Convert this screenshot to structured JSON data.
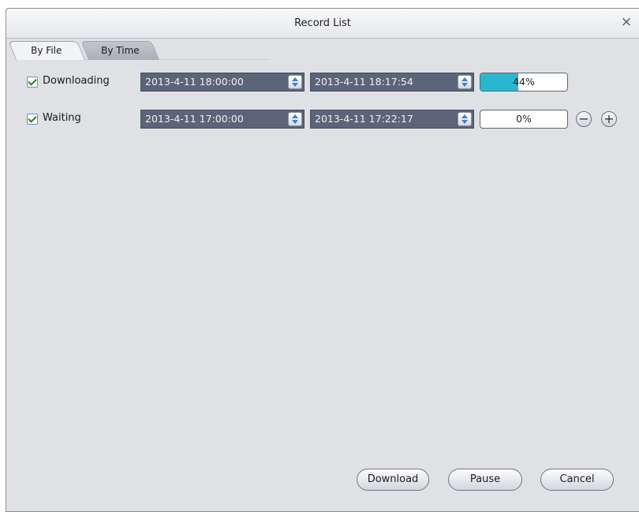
{
  "window": {
    "title": "Record List",
    "close_label": "×"
  },
  "tabs": [
    {
      "label": "By File",
      "active": true
    },
    {
      "label": "By Time",
      "active": false
    }
  ],
  "rows": [
    {
      "checked": true,
      "label": "Downloading",
      "start": "2013-4-11 18:00:00",
      "end": "2013-4-11 18:17:54",
      "progress_text": "44%",
      "progress": 44
    },
    {
      "checked": true,
      "label": "Waiting",
      "start": "2013-4-11 17:00:00",
      "end": "2013-4-11 17:22:17",
      "progress_text": "0%",
      "progress": 0
    }
  ],
  "row_actions": {
    "remove_label": "−",
    "add_label": "+"
  },
  "buttons": {
    "download": "Download",
    "pause": "Pause",
    "cancel": "Cancel"
  },
  "colors": {
    "progress_fill": "#2ab6cf",
    "datetime_bg": "#5b6478"
  },
  "icons": {
    "close": "close-icon",
    "spin": "spinner-arrows-icon",
    "remove": "minus-circle-icon",
    "add": "plus-circle-icon"
  }
}
